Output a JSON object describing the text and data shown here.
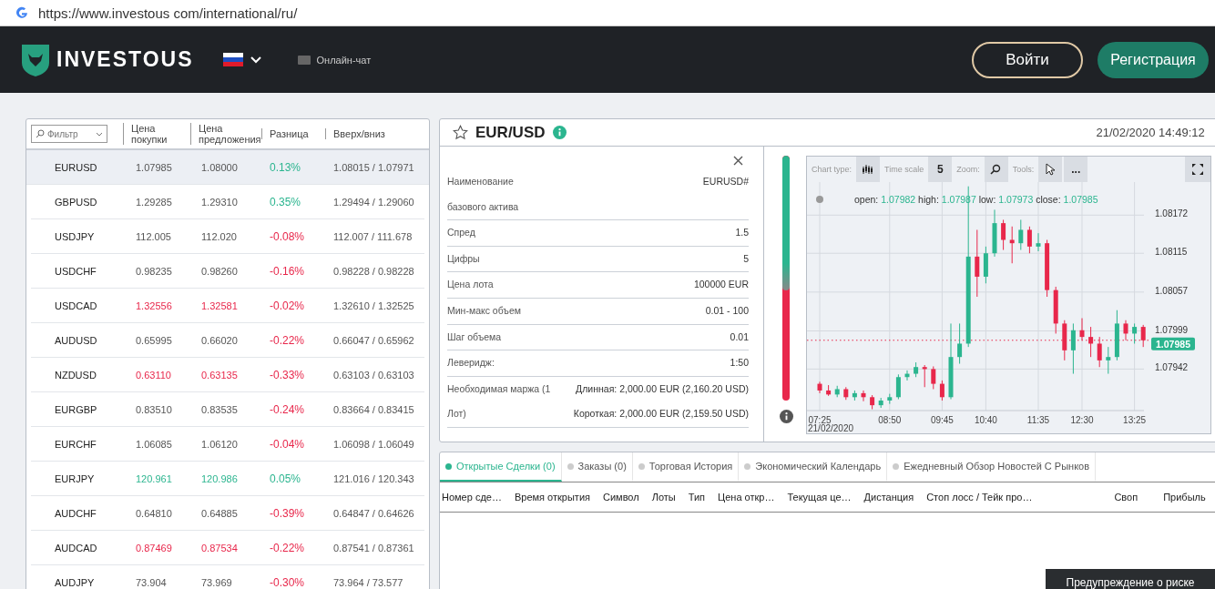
{
  "address_bar": {
    "url": "https://www.investous com/international/ru/"
  },
  "header": {
    "logo_text": "INVESTOUS",
    "chat_label": "Онлайн-чат",
    "login_button": "Войти",
    "register_button": "Регистрация"
  },
  "quotes": {
    "filter_placeholder": "Фильтр",
    "columns": [
      "Цена покупки",
      "Цена предложения",
      "Разница",
      "Вверх/вниз"
    ],
    "rows": [
      {
        "symbol": "EURUSD",
        "bid": {
          "text": "1.07985",
          "color": "#555555"
        },
        "ask": {
          "text": "1.08000",
          "color": "#555555"
        },
        "change": {
          "text": "0.13%",
          "color": "#2bb58f"
        },
        "range": "1.08015 / 1.07971",
        "selected": true
      },
      {
        "symbol": "GBPUSD",
        "bid": {
          "text": "1.29285",
          "color": "#555555"
        },
        "ask": {
          "text": "1.29310",
          "color": "#555555"
        },
        "change": {
          "text": "0.35%",
          "color": "#2bb58f"
        },
        "range": "1.29494 / 1.29060",
        "selected": false
      },
      {
        "symbol": "USDJPY",
        "bid": {
          "text": "112.005",
          "color": "#555555"
        },
        "ask": {
          "text": "112.020",
          "color": "#555555"
        },
        "change": {
          "text": "-0.08%",
          "color": "#e8274b"
        },
        "range": "112.007 / 111.678",
        "selected": false
      },
      {
        "symbol": "USDCHF",
        "bid": {
          "text": "0.98235",
          "color": "#555555"
        },
        "ask": {
          "text": "0.98260",
          "color": "#555555"
        },
        "change": {
          "text": "-0.16%",
          "color": "#e8274b"
        },
        "range": "0.98228 / 0.98228",
        "selected": false
      },
      {
        "symbol": "USDCAD",
        "bid": {
          "text": "1.32556",
          "color": "#e8274b"
        },
        "ask": {
          "text": "1.32581",
          "color": "#e8274b"
        },
        "change": {
          "text": "-0.02%",
          "color": "#e8274b"
        },
        "range": "1.32610 / 1.32525",
        "selected": false
      },
      {
        "symbol": "AUDUSD",
        "bid": {
          "text": "0.65995",
          "color": "#555555"
        },
        "ask": {
          "text": "0.66020",
          "color": "#555555"
        },
        "change": {
          "text": "-0.22%",
          "color": "#e8274b"
        },
        "range": "0.66047 / 0.65962",
        "selected": false
      },
      {
        "symbol": "NZDUSD",
        "bid": {
          "text": "0.63110",
          "color": "#e8274b"
        },
        "ask": {
          "text": "0.63135",
          "color": "#e8274b"
        },
        "change": {
          "text": "-0.33%",
          "color": "#e8274b"
        },
        "range": "0.63103 / 0.63103",
        "selected": false
      },
      {
        "symbol": "EURGBP",
        "bid": {
          "text": "0.83510",
          "color": "#555555"
        },
        "ask": {
          "text": "0.83535",
          "color": "#555555"
        },
        "change": {
          "text": "-0.24%",
          "color": "#e8274b"
        },
        "range": "0.83664 / 0.83415",
        "selected": false
      },
      {
        "symbol": "EURCHF",
        "bid": {
          "text": "1.06085",
          "color": "#555555"
        },
        "ask": {
          "text": "1.06120",
          "color": "#555555"
        },
        "change": {
          "text": "-0.04%",
          "color": "#e8274b"
        },
        "range": "1.06098 / 1.06049",
        "selected": false
      },
      {
        "symbol": "EURJPY",
        "bid": {
          "text": "120.961",
          "color": "#2bb58f"
        },
        "ask": {
          "text": "120.986",
          "color": "#2bb58f"
        },
        "change": {
          "text": "0.05%",
          "color": "#2bb58f"
        },
        "range": "121.016 / 120.343",
        "selected": false
      },
      {
        "symbol": "AUDCHF",
        "bid": {
          "text": "0.64810",
          "color": "#555555"
        },
        "ask": {
          "text": "0.64885",
          "color": "#555555"
        },
        "change": {
          "text": "-0.39%",
          "color": "#e8274b"
        },
        "range": "0.64847 / 0.64626",
        "selected": false
      },
      {
        "symbol": "AUDCAD",
        "bid": {
          "text": "0.87469",
          "color": "#e8274b"
        },
        "ask": {
          "text": "0.87534",
          "color": "#e8274b"
        },
        "change": {
          "text": "-0.22%",
          "color": "#e8274b"
        },
        "range": "0.87541 / 0.87361",
        "selected": false
      },
      {
        "symbol": "AUDJPY",
        "bid": {
          "text": "73.904",
          "color": "#555555"
        },
        "ask": {
          "text": "73.969",
          "color": "#555555"
        },
        "change": {
          "text": "-0.30%",
          "color": "#e8274b"
        },
        "range": "73.964 / 73.577",
        "selected": false
      }
    ]
  },
  "instrument": {
    "title": "EUR/USD",
    "datetime": "21/02/2020 14:49:12",
    "details": [
      {
        "label": "Наименование базового актива",
        "value": [
          "EURUSD#"
        ]
      },
      {
        "label": "Спред",
        "value": [
          "1.5"
        ]
      },
      {
        "label": "Цифры",
        "value": [
          "5"
        ]
      },
      {
        "label": "Цена лота",
        "value": [
          "100000 EUR"
        ]
      },
      {
        "label": "Мин-макс объем",
        "value": [
          "0.01 - 100"
        ]
      },
      {
        "label": "Шаг объема",
        "value": [
          "0.01"
        ]
      },
      {
        "label": "Леверидж:",
        "value": [
          "1:50"
        ]
      },
      {
        "label": "Необходимая маржа (1 Лот)",
        "value": [
          "Длинная: 2,000.00 EUR (2,160.20 USD)",
          "Короткая: 2,000.00 EUR (2,159.50 USD)"
        ]
      }
    ]
  },
  "chart": {
    "sentiment": {
      "level": 0.55
    },
    "toolbar": {
      "chart_type_label": "Chart type:",
      "time_scale_label": "Time scale",
      "time_scale_value": "5",
      "zoom_label": "Zoom:",
      "tools_label": "Tools:",
      "more_label": "..."
    },
    "legend": [
      {
        "label": "open:",
        "value": "1.07982"
      },
      {
        "label": "high:",
        "value": "1.07987"
      },
      {
        "label": "low:",
        "value": "1.07973"
      },
      {
        "label": "close:",
        "value": "1.07985"
      }
    ],
    "date_label": "21/02/2020",
    "chart_data": {
      "type": "candlestick",
      "ylim": [
        1.0788,
        1.0822
      ],
      "grid": true,
      "ref_lines": [
        {
          "axis": "y",
          "value": 1.07985,
          "color": "#e8274b",
          "label": "1.07985"
        }
      ],
      "categories": [
        "07:25",
        null,
        null,
        null,
        null,
        null,
        null,
        null,
        "08:50",
        null,
        null,
        null,
        null,
        null,
        "09:45",
        null,
        null,
        null,
        null,
        "10:40",
        null,
        null,
        null,
        null,
        null,
        "11:35",
        null,
        null,
        null,
        null,
        "12:30",
        null,
        null,
        null,
        null,
        null,
        "13:25",
        null
      ],
      "yticks": [
        1.07942,
        1.07999,
        1.08057,
        1.08115,
        1.08172
      ],
      "ohlc": [
        [
          1.0792,
          1.07923,
          1.07906,
          1.0791
        ],
        [
          1.0791,
          1.07918,
          1.07902,
          1.07904
        ],
        [
          1.07904,
          1.07917,
          1.079,
          1.07912
        ],
        [
          1.07912,
          1.07915,
          1.07896,
          1.079
        ],
        [
          1.079,
          1.0791,
          1.07895,
          1.07906
        ],
        [
          1.07906,
          1.0791,
          1.07894,
          1.079
        ],
        [
          1.079,
          1.07903,
          1.07882,
          1.07888
        ],
        [
          1.07888,
          1.07899,
          1.07884,
          1.07895
        ],
        [
          1.07895,
          1.07905,
          1.0789,
          1.079
        ],
        [
          1.079,
          1.07934,
          1.07897,
          1.0793
        ],
        [
          1.0793,
          1.0794,
          1.07925,
          1.07935
        ],
        [
          1.07935,
          1.07952,
          1.0793,
          1.07945
        ],
        [
          1.07945,
          1.07948,
          1.07915,
          1.07942
        ],
        [
          1.07942,
          1.07946,
          1.07912,
          1.0792
        ],
        [
          1.0792,
          1.07925,
          1.07895,
          1.079
        ],
        [
          1.079,
          1.0801,
          1.07897,
          1.0796
        ],
        [
          1.0796,
          1.0801,
          1.0795,
          1.0798
        ],
        [
          1.0798,
          1.08215,
          1.07975,
          1.0811
        ],
        [
          1.0811,
          1.0815,
          1.0805,
          1.0808
        ],
        [
          1.0808,
          1.08125,
          1.0807,
          1.08115
        ],
        [
          1.08115,
          1.0818,
          1.0811,
          1.0816
        ],
        [
          1.0816,
          1.08165,
          1.0812,
          1.08135
        ],
        [
          1.08135,
          1.08155,
          1.081,
          1.0813
        ],
        [
          1.0813,
          1.08165,
          1.0812,
          1.0815
        ],
        [
          1.0815,
          1.08155,
          1.08115,
          1.08125
        ],
        [
          1.08125,
          1.08145,
          1.08118,
          1.0813
        ],
        [
          1.0813,
          1.08135,
          1.0805,
          1.0806
        ],
        [
          1.0806,
          1.08065,
          1.07995,
          1.0801
        ],
        [
          1.0801,
          1.08015,
          1.07955,
          1.0797
        ],
        [
          1.0797,
          1.0801,
          1.07935,
          1.08
        ],
        [
          1.08,
          1.08018,
          1.07985,
          1.0799
        ],
        [
          1.0799,
          1.08005,
          1.0796,
          1.0798
        ],
        [
          1.0798,
          1.0799,
          1.07945,
          1.07955
        ],
        [
          1.07955,
          1.07975,
          1.07935,
          1.0796
        ],
        [
          1.0796,
          1.0803,
          1.07955,
          1.0801
        ],
        [
          1.0801,
          1.08015,
          1.07985,
          1.07995
        ],
        [
          1.07995,
          1.0801,
          1.0798,
          1.08005
        ],
        [
          1.08005,
          1.08008,
          1.07975,
          1.07985
        ]
      ]
    }
  },
  "orders": {
    "tabs": [
      {
        "label": "Открытые Сделки (0)",
        "selected": true
      },
      {
        "label": "Заказы (0)",
        "selected": false
      },
      {
        "label": "Торговая История",
        "selected": false
      },
      {
        "label": "Экономический Календарь",
        "selected": false
      },
      {
        "label": "Ежедневный Обзор Новостей С Рынков",
        "selected": false
      }
    ],
    "columns": [
      "Номер сде…",
      "Время открытия",
      "Символ",
      "Лоты",
      "Тип",
      "Цена откр…",
      "Текущая це…",
      "Дистанция",
      "Стоп лосс / Тейк про…",
      "Своп",
      "Прибыль"
    ]
  },
  "risk_warning": "Предупреждение о риске"
}
